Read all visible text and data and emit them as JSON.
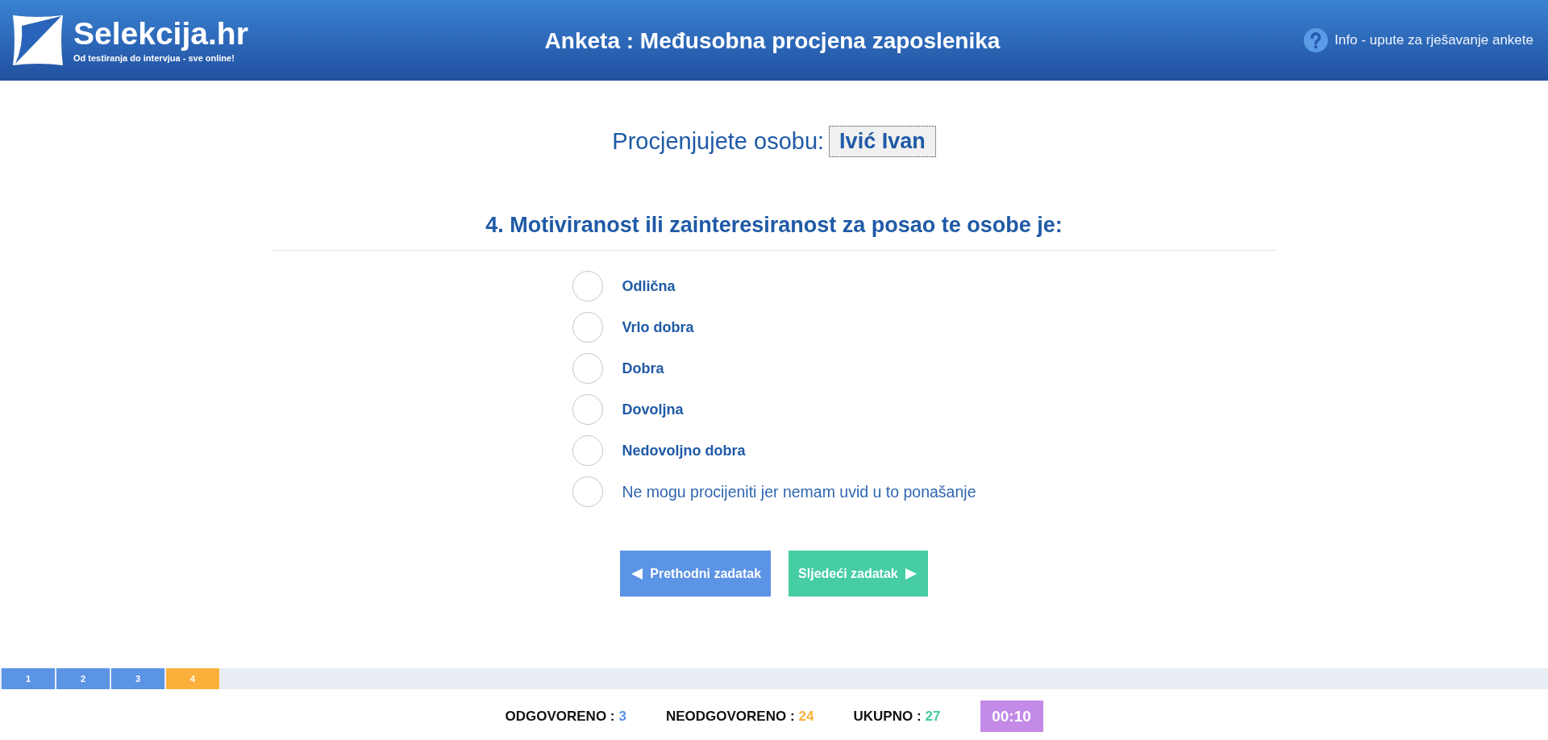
{
  "header": {
    "logo": {
      "name": "Selekcija.hr",
      "tagline": "Od testiranja do intervjua - sve online!"
    },
    "title": "Anketa : Međusobna procjena zaposlenika",
    "info_link": "Info - upute za rješavanje ankete"
  },
  "assessed_person": {
    "label": "Procjenjujete osobu:",
    "name": "Ivić Ivan"
  },
  "question": {
    "title": "4. Motiviranost ili zainteresiranost za posao te osobe je:",
    "options": [
      {
        "label": "Odlična",
        "kind": "rating",
        "selected": false
      },
      {
        "label": "Vrlo dobra",
        "kind": "rating",
        "selected": false
      },
      {
        "label": "Dobra",
        "kind": "rating",
        "selected": false
      },
      {
        "label": "Dovoljna",
        "kind": "rating",
        "selected": false
      },
      {
        "label": "Nedovoljno dobra",
        "kind": "rating",
        "selected": false
      },
      {
        "label": "Ne mogu procijeniti jer nemam uvid u to ponašanje",
        "kind": "abstain",
        "selected": false
      }
    ]
  },
  "navigation": [
    {
      "label": "Prethodni zadatak",
      "kind": "previous"
    },
    {
      "label": "Sljedeći zadatak",
      "kind": "next"
    }
  ],
  "progress": [
    {
      "label": "1",
      "answered": true,
      "selected": false
    },
    {
      "label": "2",
      "answered": true,
      "selected": false
    },
    {
      "label": "3",
      "answered": true,
      "selected": false
    },
    {
      "label": "4",
      "answered": false,
      "selected": true
    }
  ],
  "summary": [
    {
      "label": "ODGOVORENO :",
      "value": "3",
      "color": "#5b8fe6"
    },
    {
      "label": "NEODGOVORENO :",
      "value": "24",
      "color": "#fbb03b"
    },
    {
      "label": "UKUPNO :",
      "value": "27",
      "color": "#46c9a0"
    }
  ],
  "timer": "00:10"
}
